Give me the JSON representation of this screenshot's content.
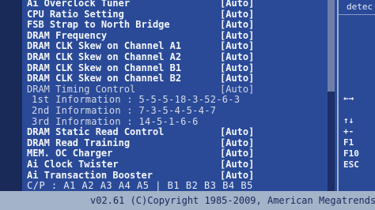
{
  "menu": {
    "items": [
      {
        "label": "Ai Overclock Tuner",
        "value": "[Auto]"
      },
      {
        "label": "CPU Ratio Setting",
        "value": "[Auto]"
      },
      {
        "label": "FSB Strap to North Bridge",
        "value": "[Auto]"
      },
      {
        "label": "DRAM Frequency",
        "value": "[Auto]"
      },
      {
        "label": "DRAM CLK Skew on Channel A1",
        "value": "[Auto]"
      },
      {
        "label": "DRAM CLK Skew on Channel A2",
        "value": "[Auto]"
      },
      {
        "label": "DRAM CLK Skew on Channel B1",
        "value": "[Auto]"
      },
      {
        "label": "DRAM CLK Skew on Channel B2",
        "value": "[Auto]"
      },
      {
        "label": "DRAM Timing Control",
        "value": "[Auto]"
      }
    ],
    "timings": [
      {
        "label": "1st Information : 5-5-5-18-3-52-6-3"
      },
      {
        "label": "2nd Information : 7-3-5-4-5-4-7"
      },
      {
        "label": "3rd Information : 14-5-1-6-6"
      }
    ],
    "items_after": [
      {
        "label": "DRAM Static Read Control",
        "value": "[Auto]"
      },
      {
        "label": "DRAM Read Training",
        "value": "[Auto]"
      },
      {
        "label": "MEM. OC Charger",
        "value": "[Auto]"
      },
      {
        "label": "Ai Clock Twister",
        "value": "[Auto]"
      },
      {
        "label": "Ai Transaction Booster",
        "value": "[Auto]"
      }
    ],
    "cp_row": "C/P : A1 A2 A3 A4 A5 | B1 B2 B3 B4 B5"
  },
  "scrollbar": {
    "position_fraction": 0.0,
    "thumb_fraction": 0.48
  },
  "side": {
    "description": "detec",
    "keys": [
      "←→",
      "↑↓",
      "+-",
      "F1",
      "F10",
      "ESC"
    ]
  },
  "footer": {
    "copyright": "v02.61 (C)Copyright 1985-2009, American Megatrends"
  },
  "colors": {
    "pane_background": "#2a4a98",
    "frame_background": "#a3b3c8",
    "text": "#f4f6fa",
    "footer_text": "#18285a"
  }
}
